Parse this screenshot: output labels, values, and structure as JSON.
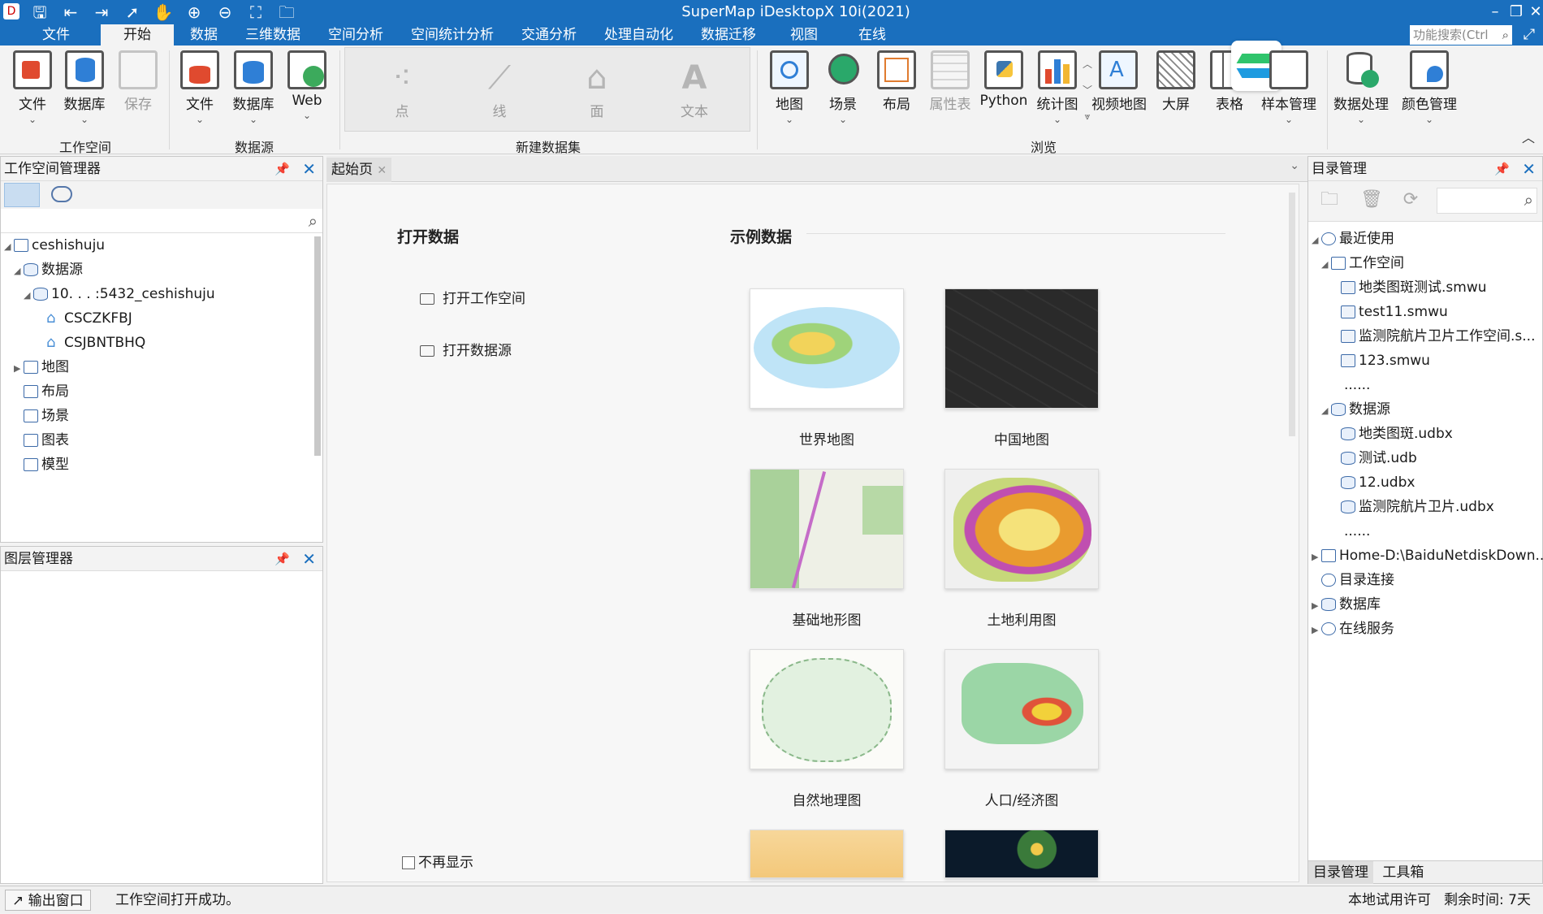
{
  "title": "SuperMap iDesktopX 10i(2021)",
  "menu_tabs": [
    "文件",
    "开始",
    "数据",
    "三维数据",
    "空间分析",
    "空间统计分析",
    "交通分析",
    "处理自动化",
    "数据迁移",
    "视图",
    "在线"
  ],
  "active_tab": "开始",
  "search": {
    "placeholder": "功能搜索(Ctrl"
  },
  "ribbon": {
    "workspace": {
      "group": "工作空间",
      "file": "文件",
      "database": "数据库",
      "save": "保存"
    },
    "datasource": {
      "group": "数据源",
      "file": "文件",
      "database": "数据库",
      "web": "Web"
    },
    "new_dataset": {
      "group": "新建数据集",
      "point": "点",
      "line": "线",
      "region": "面",
      "text": "文本"
    },
    "browse": {
      "group": "浏览",
      "map": "地图",
      "scene": "场景",
      "layout": "布局",
      "attr": "属性表",
      "python": "Python",
      "chart": "统计图",
      "video": "视频地图",
      "screen": "大屏",
      "table": "表格",
      "sample": "样本管理"
    },
    "process": {
      "data": "数据处理",
      "color": "颜色管理"
    }
  },
  "workspace_manager": {
    "title": "工作空间管理器",
    "tree": {
      "root": "ceshishuju",
      "datasources": "数据源",
      "conn": "10.  .  .  :5432_ceshishuju",
      "ds1": "CSCZKFBJ",
      "ds2": "CSJBNTBHQ",
      "maps": "地图",
      "layouts": "布局",
      "scenes": "场景",
      "charts": "图表",
      "models": "模型"
    }
  },
  "layer_manager": {
    "title": "图层管理器"
  },
  "doc_tab": "起始页",
  "start_page": {
    "open_title": "打开数据",
    "open_ws": "打开工作空间",
    "open_ds": "打开数据源",
    "sample_title": "示例数据",
    "samples": [
      "世界地图",
      "中国地图",
      "基础地形图",
      "土地利用图",
      "自然地理图",
      "人口/经济图"
    ],
    "dont_show": "不再显示"
  },
  "catalog": {
    "title": "目录管理",
    "recent": "最近使用",
    "workspace": "工作空间",
    "ws_files": [
      "地类图斑测试.smwu",
      "test11.smwu",
      "监测院航片卫片工作空间.s...",
      "123.smwu"
    ],
    "more": "......",
    "datasource": "数据源",
    "ds_files": [
      "地类图斑.udbx",
      "测试.udb",
      "12.udbx",
      "监测院航片卫片.udbx"
    ],
    "home": "Home-D:\\BaiduNetdiskDown...",
    "dir_conn": "目录连接",
    "database": "数据库",
    "online": "在线服务",
    "tabs": [
      "目录管理",
      "工具箱"
    ]
  },
  "status": {
    "output": "输出窗口",
    "message": "工作空间打开成功。",
    "license": "本地试用许可",
    "remaining": "剩余时间: 7天"
  }
}
